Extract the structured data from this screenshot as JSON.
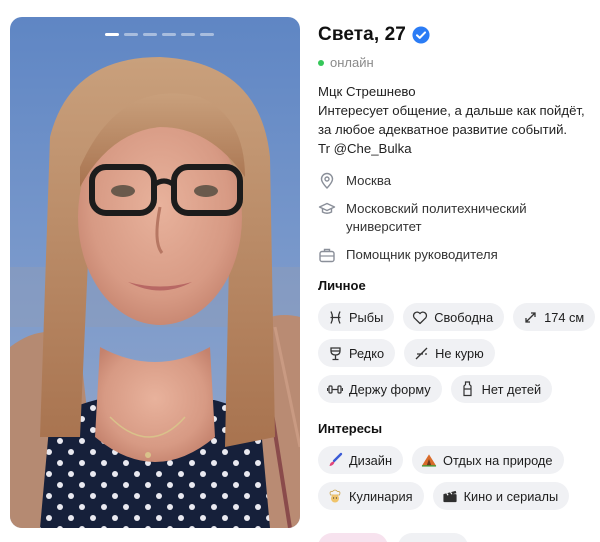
{
  "profile": {
    "name_age": "Света, 27",
    "verified_icon": "verified-check-icon",
    "status": "онлайн",
    "status_color": "#35c759",
    "accent": "#2b7cf5"
  },
  "photo": {
    "dots_count_active": 1,
    "dots_total": 6
  },
  "bio": {
    "lines": [
      "Мцк Стрешнево",
      "Интересует общение, а дальше как пойдёт,",
      "за любое адекватное развитие событий.",
      "Tr @Che_Bulka"
    ]
  },
  "facts": {
    "city": "Москва",
    "education": "Московский политехнический университет",
    "job": "Помощник руководителя"
  },
  "personal": {
    "title": "Личное",
    "chips": [
      {
        "icon": "pisces-icon",
        "label": "Рыбы"
      },
      {
        "icon": "heart-icon",
        "label": "Свободна"
      },
      {
        "icon": "height-icon",
        "label": "174 см"
      },
      {
        "icon": "wine-glass-icon",
        "label": "Редко"
      },
      {
        "icon": "no-smoking-icon",
        "label": "Не курю"
      },
      {
        "icon": "dumbbell-icon",
        "label": "Держу форму"
      },
      {
        "icon": "bottle-icon",
        "label": "Нет детей"
      }
    ]
  },
  "interests": {
    "title": "Интересы",
    "chips": [
      {
        "icon": "paintbrush-icon",
        "label": "Дизайн"
      },
      {
        "icon": "camping-icon",
        "label": "Отдых на природе"
      },
      {
        "icon": "chef-icon",
        "label": "Кулинария"
      },
      {
        "icon": "clapperboard-icon",
        "label": "Кино и сериалы"
      }
    ]
  }
}
